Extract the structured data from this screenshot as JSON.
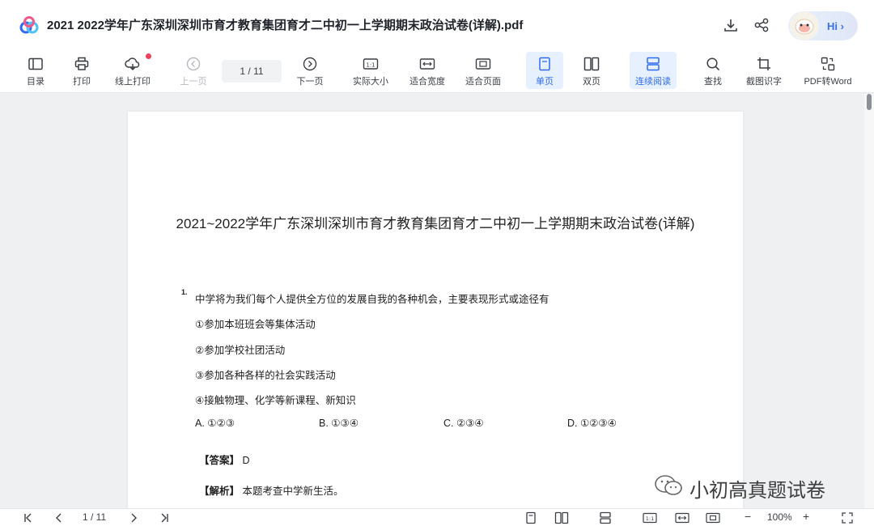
{
  "titlebar": {
    "document_title": "2021  2022学年广东深圳深圳市育才教育集团育才二中初一上学期期末政治试卷(详解).pdf",
    "assistant_label": "Hi ›",
    "icons": [
      "download-icon",
      "share-icon"
    ]
  },
  "toolbar": {
    "items": [
      {
        "label": "目录",
        "icon": "outline-icon"
      },
      {
        "label": "打印",
        "icon": "printer-icon"
      },
      {
        "label": "线上打印",
        "icon": "cloud-print-icon"
      },
      {
        "label": "上一页",
        "icon": "prev-page-icon"
      },
      {
        "label": "下一页",
        "icon": "next-page-icon"
      },
      {
        "label": "实际大小",
        "icon": "actual-size-icon"
      },
      {
        "label": "适合宽度",
        "icon": "fit-width-icon"
      },
      {
        "label": "适合页面",
        "icon": "fit-page-icon"
      },
      {
        "label": "单页",
        "icon": "single-page-icon"
      },
      {
        "label": "双页",
        "icon": "double-page-icon"
      },
      {
        "label": "连续阅读",
        "icon": "continuous-icon"
      },
      {
        "label": "查找",
        "icon": "search-icon"
      },
      {
        "label": "截图识字",
        "icon": "crop-ocr-icon"
      },
      {
        "label": "PDF转Word",
        "icon": "pdf-to-word-icon"
      }
    ],
    "page_indicator": "1  / 11",
    "active_items": [
      "单页",
      "连续阅读"
    ],
    "notification_color": "#f0405a",
    "accent_color": "#2f6bf0"
  },
  "document": {
    "title": "2021~2022学年广东深圳深圳市育才教育集团育才二中初一上学期期末政治试卷(详解)",
    "question_number": "1.",
    "question_text": "中学将为我们每个人提供全方位的发展自我的各种机会，主要表现形式或途径有",
    "items": [
      "①参加本班班会等集体活动",
      "②参加学校社团活动",
      "③参加各种各样的社会实践活动",
      "④接触物理、化学等新课程、新知识"
    ],
    "options": [
      "A. ①②③",
      "B. ①③④",
      "C. ②③④",
      "D. ①②③④"
    ],
    "answer_label": "【答案】",
    "answer_value": "D",
    "analysis_label": "【解析】",
    "analysis_text": "本题考查中学新生活。"
  },
  "watermark": {
    "text": "小初高真题试卷"
  },
  "bottombar": {
    "page_indicator": "1  / 11",
    "zoom": "100%",
    "zoom_minus": "−",
    "zoom_plus": "+"
  }
}
